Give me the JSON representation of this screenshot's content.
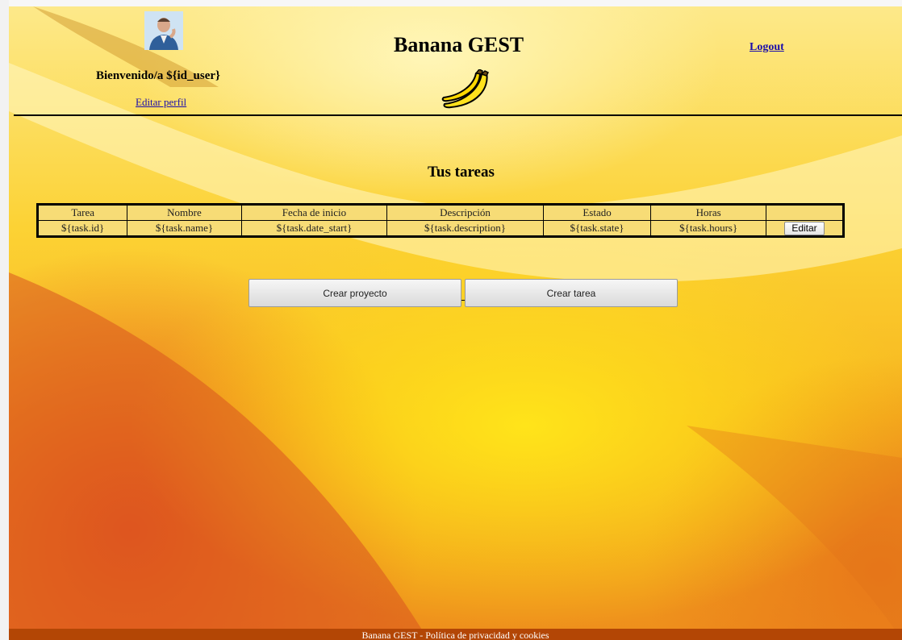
{
  "header": {
    "welcome": "Bienvenido/a ${id_user}",
    "edit_profile": "Editar perfil",
    "title": "Banana GEST",
    "logout": "Logout"
  },
  "main": {
    "section_title": "Tus tareas",
    "table": {
      "columns": [
        "Tarea",
        "Nombre",
        "Fecha de inicio",
        "Descripción",
        "Estado",
        "Horas",
        ""
      ],
      "rows": [
        {
          "cells": [
            "${task.id}",
            "${task.name}",
            "${task.date_start}",
            "${task.description}",
            "${task.state}",
            "${task.hours}"
          ],
          "action": "Editar"
        }
      ]
    },
    "buttons": {
      "create_project": "Crear proyecto",
      "create_task": "Crear tarea"
    }
  },
  "footer": {
    "text": "Banana GEST - Política de privacidad y cookies"
  },
  "colors": {
    "table_bg": "#f7dc76",
    "footer_bg": "#b34605",
    "link": "#1a0dab"
  },
  "icons": {
    "avatar": "user-avatar-photo",
    "logo": "banana-icon"
  }
}
